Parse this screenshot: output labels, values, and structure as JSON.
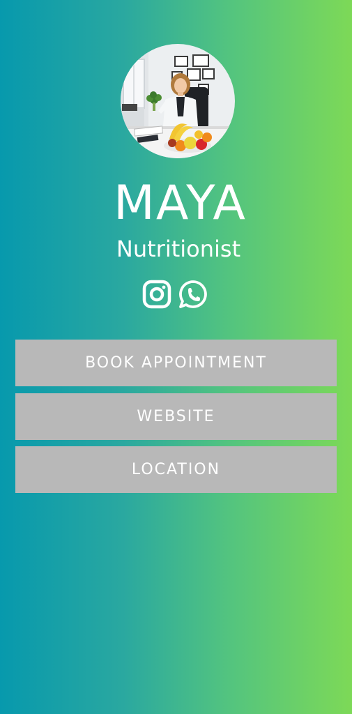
{
  "profile": {
    "name": "MAYA",
    "title": "Nutritionist"
  },
  "socials": {
    "instagram": "instagram-icon",
    "whatsapp": "whatsapp-icon"
  },
  "links": {
    "book": "BOOK APPOINTMENT",
    "website": "WEBSITE",
    "location": "LOCATION"
  },
  "colors": {
    "gradient_left": "#0799ad",
    "gradient_right": "#7dd957",
    "button_bg": "#b8b8b8",
    "text": "#ffffff"
  }
}
